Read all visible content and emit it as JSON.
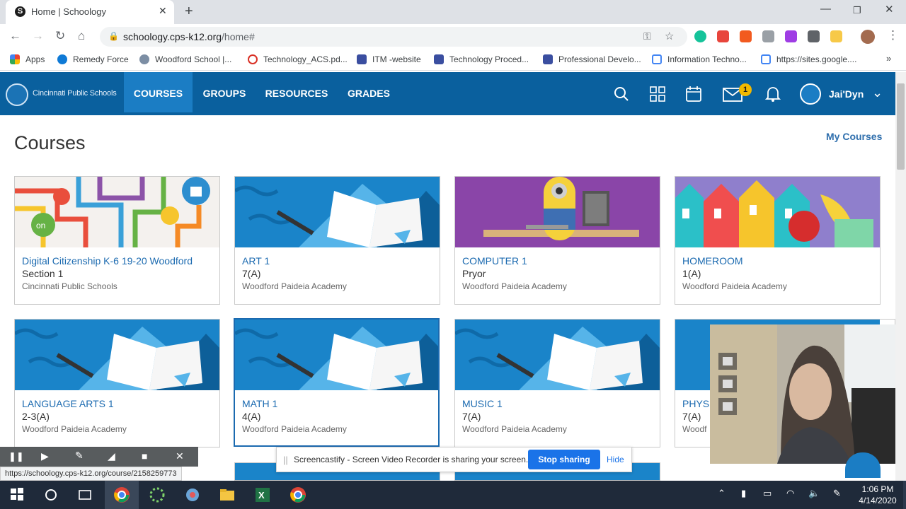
{
  "browser": {
    "tab_title": "Home | Schoology",
    "tab_favicon": "S",
    "url_host": "schoology.cps-k12.org",
    "url_path": "/home#",
    "bookmarks": [
      "Apps",
      "Remedy Force",
      "Woodford School |...",
      "Technology_ACS.pd...",
      "ITM -website",
      "Technology Proced...",
      "Professional Develo...",
      "Information Techno...",
      "https://sites.google...."
    ]
  },
  "header": {
    "logo_text": "Cincinnati Public Schools",
    "nav": [
      "COURSES",
      "GROUPS",
      "RESOURCES",
      "GRADES"
    ],
    "message_badge": "1",
    "user_name": "Jai'Dyn",
    "accent_color": "#0a609e"
  },
  "main": {
    "title": "Courses",
    "my_courses_link": "My Courses",
    "courses": [
      {
        "name": "Digital Citizenship K-6 19-20 Woodford",
        "section": "Section 1",
        "org": "Cincinnati Public Schools"
      },
      {
        "name": "ART 1",
        "section": "7(A)",
        "org": "Woodford Paideia Academy"
      },
      {
        "name": "COMPUTER 1",
        "section": "Pryor",
        "org": "Woodford Paideia Academy"
      },
      {
        "name": "HOMEROOM",
        "section": "1(A)",
        "org": "Woodford Paideia Academy"
      },
      {
        "name": "LANGUAGE ARTS 1",
        "section": "2-3(A)",
        "org": "Woodford Paideia Academy"
      },
      {
        "name": "MATH 1",
        "section": "4(A)",
        "org": "Woodford Paideia Academy"
      },
      {
        "name": "MUSIC 1",
        "section": "7(A)",
        "org": "Woodford Paideia Academy"
      },
      {
        "name": "PHYS",
        "section": "7(A)",
        "org": "Woodf"
      }
    ]
  },
  "screencastify": {
    "message": "Screencastify - Screen Video Recorder is sharing your screen.",
    "stop_label": "Stop sharing",
    "hide_label": "Hide"
  },
  "status_url": "https://schoology.cps-k12.org/course/2158259773",
  "taskbar": {
    "time": "1:06 PM",
    "date": "4/14/2020"
  }
}
